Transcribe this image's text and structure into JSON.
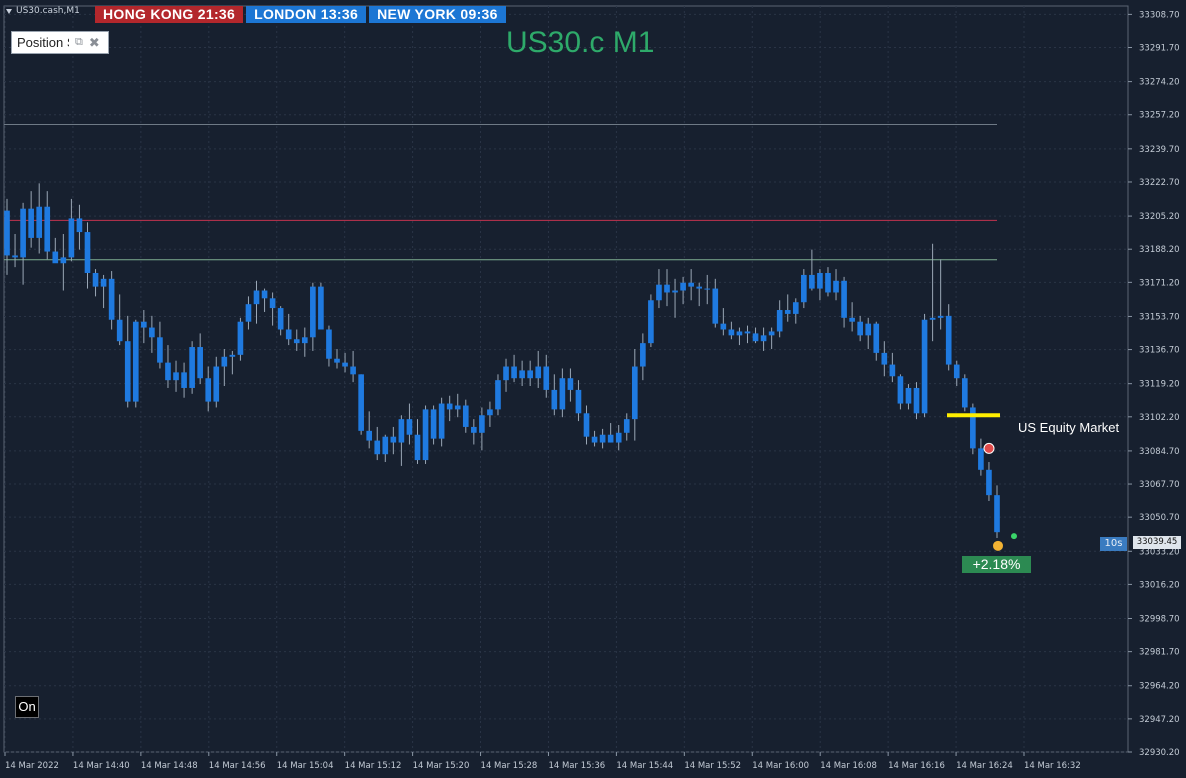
{
  "window": {
    "symbol_tab": "US30.cash,M1"
  },
  "sessions": [
    {
      "label": "HONG KONG 21:36",
      "color": "#b3272c"
    },
    {
      "label": "LONDON  13:36",
      "color": "#1c76d4"
    },
    {
      "label": "NEW YORK  09:36",
      "color": "#1c76d4"
    }
  ],
  "position_panel": {
    "label": "Position S",
    "icons": [
      "restore-icon",
      "close-icon"
    ]
  },
  "chart_title": "US30.c M1",
  "annotations": {
    "equity_market_label": "US Equity Market",
    "percent_change": "+2.18%",
    "bar_timer": "10s",
    "current_price": "33039.45"
  },
  "on_button_label": "On",
  "chart_data": {
    "type": "candlestick",
    "title": "US30.c M1",
    "symbol": "US30.cash",
    "timeframe": "M1",
    "ylim": [
      32930.2,
      33313.0
    ],
    "y_ticks": [
      "33308.70",
      "33291.70",
      "33274.20",
      "33257.20",
      "33239.70",
      "33222.70",
      "33205.20",
      "33188.20",
      "33171.20",
      "33153.70",
      "33136.70",
      "33119.20",
      "33102.20",
      "33084.70",
      "33067.70",
      "33050.70",
      "33033.20",
      "33016.20",
      "32998.70",
      "32981.70",
      "32964.20",
      "32947.20",
      "32930.20"
    ],
    "x_ticks": [
      "14 Mar 2022",
      "14 Mar 14:40",
      "14 Mar 14:48",
      "14 Mar 14:56",
      "14 Mar 15:04",
      "14 Mar 15:12",
      "14 Mar 15:20",
      "14 Mar 15:28",
      "14 Mar 15:36",
      "14 Mar 15:44",
      "14 Mar 15:52",
      "14 Mar 16:00",
      "14 Mar 16:08",
      "14 Mar 16:16",
      "14 Mar 16:24",
      "14 Mar 16:32"
    ],
    "horizontal_lines": [
      {
        "price": 33252.2,
        "color": "#6f7a86"
      },
      {
        "price": 33203.0,
        "color": "#c2334f"
      },
      {
        "price": 33182.8,
        "color": "#7fae91"
      }
    ],
    "equity_level": {
      "price": 33103.0,
      "color": "#ffee00"
    },
    "grid": true,
    "up_color": "#1f7ae0",
    "down_color": "#1f7ae0",
    "candles": [
      [
        33208,
        33214,
        33175,
        33185
      ],
      [
        33185,
        33196,
        33179,
        33184
      ],
      [
        33184,
        33212,
        33170,
        33209
      ],
      [
        33209,
        33218,
        33189,
        33194
      ],
      [
        33194,
        33222,
        33186,
        33210
      ],
      [
        33210,
        33218,
        33183,
        33187
      ],
      [
        33187,
        33194,
        33182,
        33181
      ],
      [
        33181,
        33196,
        33167,
        33184
      ],
      [
        33184,
        33214,
        33182,
        33204
      ],
      [
        33204,
        33211,
        33188,
        33197
      ],
      [
        33197,
        33202,
        33168,
        33176
      ],
      [
        33176,
        33178,
        33164,
        33169
      ],
      [
        33169,
        33175,
        33158,
        33173
      ],
      [
        33173,
        33177,
        33147,
        33152
      ],
      [
        33152,
        33165,
        33139,
        33141
      ],
      [
        33141,
        33154,
        33107,
        33110
      ],
      [
        33110,
        33152,
        33107,
        33151
      ],
      [
        33151,
        33157,
        33140,
        33148
      ],
      [
        33148,
        33154,
        33135,
        33143
      ],
      [
        33143,
        33151,
        33127,
        33130
      ],
      [
        33130,
        33139,
        33117,
        33121
      ],
      [
        33121,
        33131,
        33115,
        33125
      ],
      [
        33125,
        33130,
        33112,
        33117
      ],
      [
        33117,
        33141,
        33114,
        33138
      ],
      [
        33138,
        33145,
        33119,
        33122
      ],
      [
        33122,
        33128,
        33105,
        33110
      ],
      [
        33110,
        33133,
        33107,
        33128
      ],
      [
        33128,
        33137,
        33118,
        33133
      ],
      [
        33133,
        33136,
        33124,
        33134
      ],
      [
        33134,
        33153,
        33131,
        33151
      ],
      [
        33151,
        33164,
        33147,
        33160
      ],
      [
        33160,
        33172,
        33150,
        33167
      ],
      [
        33167,
        33168,
        33156,
        33163
      ],
      [
        33163,
        33166,
        33149,
        33158
      ],
      [
        33158,
        33159,
        33144,
        33147
      ],
      [
        33147,
        33155,
        33139,
        33142
      ],
      [
        33142,
        33147,
        33136,
        33140
      ],
      [
        33140,
        33148,
        33133,
        33143
      ],
      [
        33143,
        33171,
        33136,
        33169
      ],
      [
        33169,
        33171,
        33147,
        33147
      ],
      [
        33147,
        33149,
        33128,
        33132
      ],
      [
        33132,
        33137,
        33127,
        33130
      ],
      [
        33130,
        33135,
        33125,
        33128
      ],
      [
        33128,
        33136,
        33120,
        33124
      ],
      [
        33124,
        33124,
        33093,
        33095
      ],
      [
        33095,
        33105,
        33086,
        33090
      ],
      [
        33090,
        33097,
        33080,
        33083
      ],
      [
        33083,
        33093,
        33079,
        33092
      ],
      [
        33092,
        33097,
        33083,
        33089
      ],
      [
        33089,
        33103,
        33077,
        33101
      ],
      [
        33101,
        33109,
        33088,
        33093
      ],
      [
        33093,
        33101,
        33078,
        33080
      ],
      [
        33080,
        33108,
        33078,
        33106
      ],
      [
        33106,
        33108,
        33088,
        33091
      ],
      [
        33091,
        33112,
        33087,
        33109
      ],
      [
        33109,
        33113,
        33100,
        33106
      ],
      [
        33106,
        33114,
        33102,
        33108
      ],
      [
        33108,
        33111,
        33094,
        33097
      ],
      [
        33097,
        33101,
        33088,
        33094
      ],
      [
        33094,
        33107,
        33085,
        33103
      ],
      [
        33103,
        33110,
        33097,
        33106
      ],
      [
        33106,
        33124,
        33103,
        33121
      ],
      [
        33121,
        33132,
        33115,
        33128
      ],
      [
        33128,
        33134,
        33120,
        33122
      ],
      [
        33122,
        33131,
        33118,
        33126
      ],
      [
        33126,
        33131,
        33118,
        33122
      ],
      [
        33122,
        33136,
        33117,
        33128
      ],
      [
        33128,
        33134,
        33112,
        33116
      ],
      [
        33116,
        33124,
        33103,
        33106
      ],
      [
        33106,
        33127,
        33102,
        33122
      ],
      [
        33122,
        33127,
        33110,
        33116
      ],
      [
        33116,
        33121,
        33100,
        33104
      ],
      [
        33104,
        33108,
        33088,
        33092
      ],
      [
        33092,
        33095,
        33087,
        33089
      ],
      [
        33089,
        33096,
        33086,
        33093
      ],
      [
        33093,
        33099,
        33089,
        33089
      ],
      [
        33089,
        33098,
        33085,
        33094
      ],
      [
        33094,
        33104,
        33090,
        33101
      ],
      [
        33101,
        33137,
        33090,
        33128
      ],
      [
        33128,
        33145,
        33121,
        33140
      ],
      [
        33140,
        33165,
        33138,
        33162
      ],
      [
        33162,
        33178,
        33158,
        33170
      ],
      [
        33170,
        33178,
        33159,
        33166
      ],
      [
        33166,
        33173,
        33153,
        33167
      ],
      [
        33167,
        33174,
        33160,
        33171
      ],
      [
        33171,
        33178,
        33162,
        33169
      ],
      [
        33169,
        33171,
        33159,
        33168
      ],
      [
        33168,
        33175,
        33160,
        33168
      ],
      [
        33168,
        33173,
        33148,
        33150
      ],
      [
        33150,
        33158,
        33144,
        33147
      ],
      [
        33147,
        33151,
        33142,
        33144
      ],
      [
        33144,
        33148,
        33139,
        33146
      ],
      [
        33146,
        33149,
        33140,
        33145
      ],
      [
        33145,
        33148,
        33140,
        33141
      ],
      [
        33141,
        33148,
        33136,
        33144
      ],
      [
        33144,
        33148,
        33137,
        33146
      ],
      [
        33146,
        33162,
        33143,
        33157
      ],
      [
        33157,
        33165,
        33151,
        33155
      ],
      [
        33155,
        33163,
        33150,
        33161
      ],
      [
        33161,
        33178,
        33158,
        33175
      ],
      [
        33175,
        33188,
        33167,
        33168
      ],
      [
        33168,
        33178,
        33162,
        33176
      ],
      [
        33176,
        33179,
        33164,
        33166
      ],
      [
        33166,
        33178,
        33162,
        33172
      ],
      [
        33172,
        33174,
        33148,
        33153
      ],
      [
        33153,
        33161,
        33146,
        33151
      ],
      [
        33151,
        33154,
        33141,
        33144
      ],
      [
        33144,
        33153,
        33137,
        33150
      ],
      [
        33150,
        33151,
        33131,
        33135
      ],
      [
        33135,
        33141,
        33123,
        33129
      ],
      [
        33129,
        33135,
        33120,
        33123
      ],
      [
        33123,
        33124,
        33106,
        33109
      ],
      [
        33109,
        33119,
        33106,
        33117
      ],
      [
        33117,
        33120,
        33101,
        33104
      ],
      [
        33104,
        33155,
        33102,
        33152
      ],
      [
        33152,
        33191,
        33141,
        33153
      ],
      [
        33153,
        33183,
        33147,
        33154
      ],
      [
        33154,
        33160,
        33126,
        33129
      ],
      [
        33129,
        33131,
        33118,
        33122
      ],
      [
        33122,
        33124,
        33105,
        33107
      ],
      [
        33107,
        33109,
        33083,
        33086
      ],
      [
        33086,
        33091,
        33072,
        33075
      ],
      [
        33075,
        33079,
        33059,
        33062
      ],
      [
        33062,
        33067,
        33040,
        33043
      ]
    ]
  }
}
